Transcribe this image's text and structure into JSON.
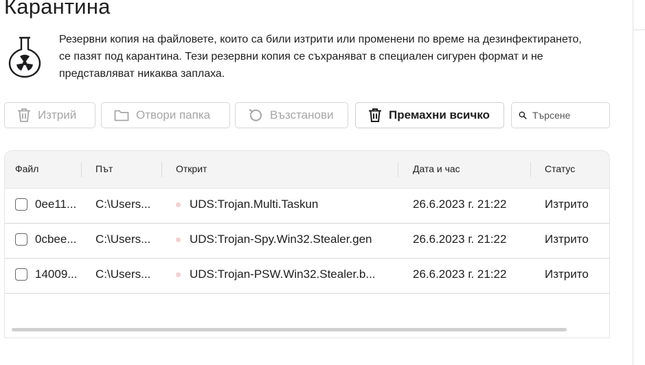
{
  "page": {
    "title": "Карантина",
    "description": "Резервни копия на файловете, които са били изтрити или променени по време на дезинфектирането, се пазят под карантина. Тези резервни копия се съхраняват в специален сигурен формат и не представляват никаква заплаха."
  },
  "toolbar": {
    "delete_label": "Изтрий",
    "open_folder_label": "Отвори папка",
    "restore_label": "Възстанови",
    "remove_all_label": "Премахни всичко",
    "search_placeholder": "Търсене"
  },
  "table": {
    "columns": [
      "Файл",
      "Път",
      "Открит",
      "Дата и час",
      "Статус"
    ],
    "rows": [
      {
        "file": "0ee11...",
        "path": "C:\\Users...",
        "detected": "UDS:Trojan.Multi.Taskun",
        "datetime": "26.6.2023 г. 21:22",
        "status": "Изтрито"
      },
      {
        "file": "0cbee...",
        "path": "C:\\Users...",
        "detected": "UDS:Trojan-Spy.Win32.Stealer.gen",
        "datetime": "26.6.2023 г. 21:22",
        "status": "Изтрито"
      },
      {
        "file": "14009...",
        "path": "C:\\Users...",
        "detected": "UDS:Trojan-PSW.Win32.Stealer.b...",
        "datetime": "26.6.2023 г. 21:22",
        "status": "Изтрито"
      }
    ]
  },
  "colors": {
    "threat_dot": "#f6d0d0",
    "disabled_text": "#a6a6a6",
    "text": "#1d1d1f"
  }
}
